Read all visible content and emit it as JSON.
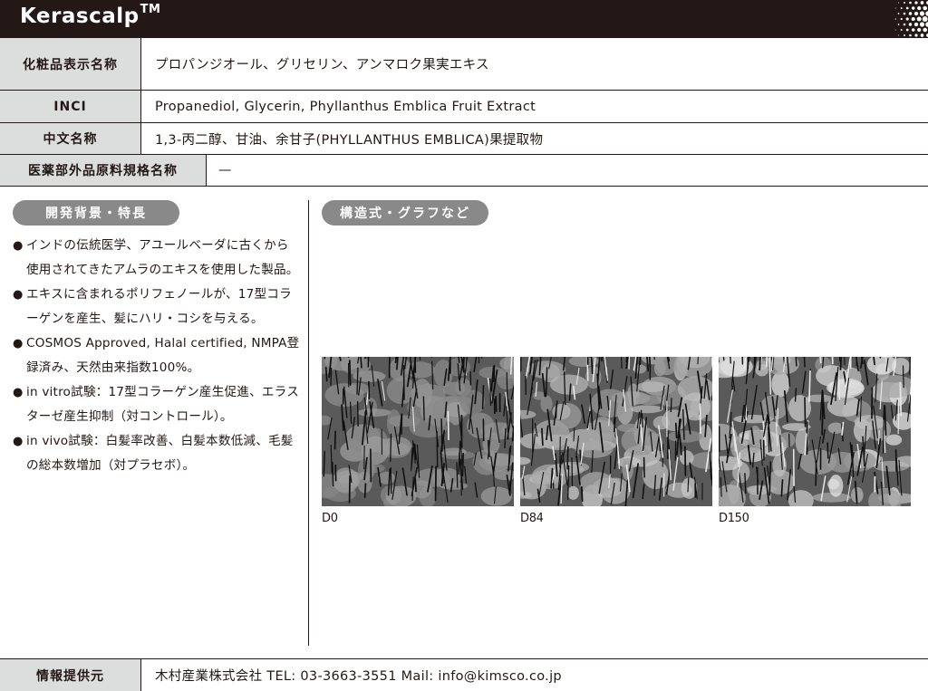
{
  "header": {
    "title": "Kerascalp",
    "trademark": "TM"
  },
  "spec_rows": [
    {
      "label": "化粧品表示名称",
      "value": "プロパンジオール、グリセリン、アンマロク果実エキス"
    },
    {
      "label": "INCI",
      "value": "Propanediol, Glycerin, Phyllanthus Emblica Fruit Extract"
    },
    {
      "label": "中文名称",
      "value": "1,3-丙二醇、甘油、余甘子(PHYLLANTHUS EMBLICA)果提取物"
    },
    {
      "label": "医薬部外品原料規格名称",
      "value": "—"
    }
  ],
  "sections": {
    "background_label": "開発背景・特長",
    "structure_label": "構造式・グラフなど"
  },
  "features": [
    {
      "bullet": "●",
      "text": "インドの伝統医学、アユールベーダに古くから使用されてきたアムラのエキスを使用した製品。"
    },
    {
      "bullet": "●",
      "text": "エキスに含まれるポリフェノールが、17型コラーゲンを産生、髪にハリ・コシを与える。"
    },
    {
      "bullet": "●",
      "text": "COSMOS Approved, Halal certified, NMPA登録済み、天然由来指数100%。"
    },
    {
      "bullet": "●",
      "text": "in vitro試験：17型コラーゲン産生促進、エラスターゼ産生抑制（対コントロール）。"
    },
    {
      "bullet": "●",
      "text": "in vivo試験：白髪率改善、白髪本数低減、毛髪の総本数増加（対プラセボ）。"
    }
  ],
  "photos": [
    {
      "caption": "D0",
      "icon": "scalp-photo-icon"
    },
    {
      "caption": "D84",
      "icon": "scalp-photo-icon"
    },
    {
      "caption": "D150",
      "icon": "scalp-photo-icon"
    }
  ],
  "footer": {
    "label": "情報提供元",
    "value": "木村産業株式会社  TEL: 03-3663-3551  Mail: info@kimsco.co.jp"
  },
  "colors": {
    "header_bg": "#231815",
    "label_bg": "#dcdddd",
    "pill_bg": "#898989"
  }
}
